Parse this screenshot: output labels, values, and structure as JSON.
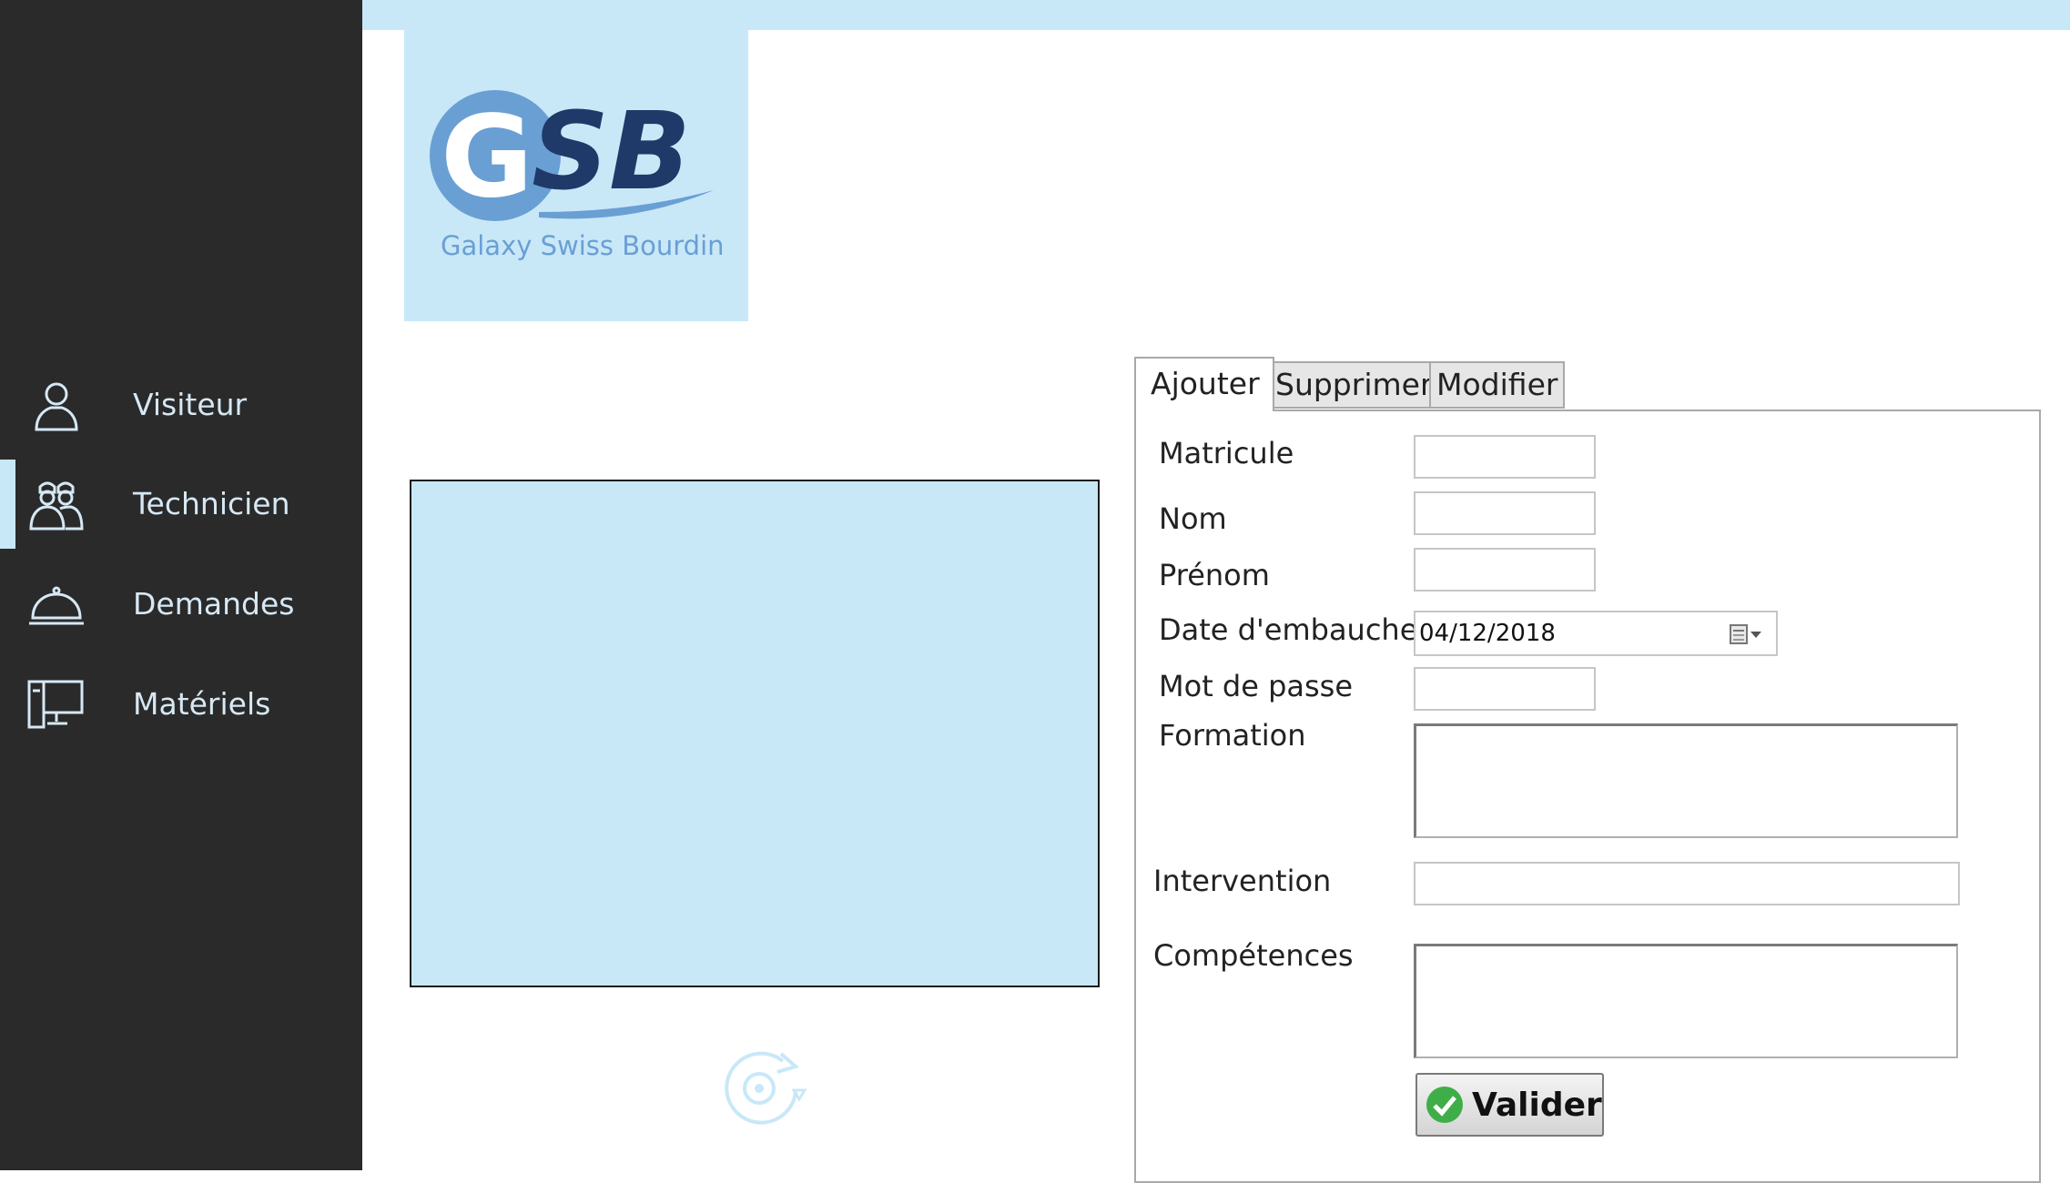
{
  "sidebar": {
    "items": [
      {
        "label": "Visiteur",
        "icon": "person-icon"
      },
      {
        "label": "Technicien",
        "icon": "technicians-icon",
        "active": true
      },
      {
        "label": "Demandes",
        "icon": "service-bell-icon"
      },
      {
        "label": "Matériels",
        "icon": "computer-icon"
      }
    ],
    "active_color": "#c8e8f8"
  },
  "logo": {
    "text": "GSB",
    "subtitle": "Galaxy Swiss Bourdin"
  },
  "tabs": [
    {
      "label": "Ajouter",
      "selected": true
    },
    {
      "label": "Supprimer"
    },
    {
      "label": "Modifier"
    }
  ],
  "form": {
    "matricule_label": "Matricule",
    "nom_label": "Nom",
    "prenom_label": "Prénom",
    "date_label": "Date d'embauche",
    "date_value": "04/12/2018",
    "password_label": "Mot de passe",
    "formation_label": "Formation",
    "intervention_label": "Intervention",
    "competences_label": "Compétences",
    "submit_label": "Valider"
  },
  "colors": {
    "sidebar_bg": "#2a2a2a",
    "accent": "#c8e8f8",
    "logo_blue": "#6a9fd4",
    "logo_navy": "#1f3a68"
  }
}
